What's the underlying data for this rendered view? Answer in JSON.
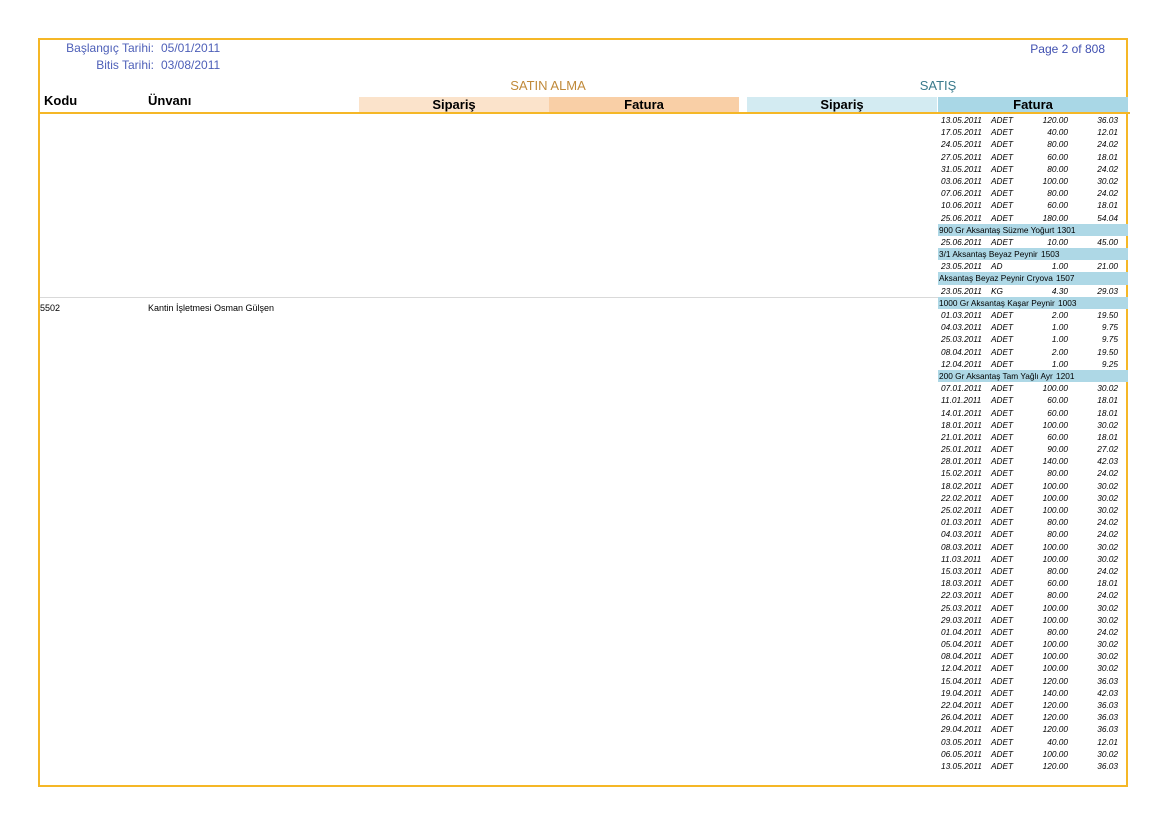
{
  "header": {
    "start_label": "Başlangıç Tarihi:",
    "start_value": "05/01/2011",
    "end_label": "Bitis Tarihi:",
    "end_value": "03/08/2011",
    "page": "Page 2 of 808"
  },
  "groups": {
    "buy": "SATIN ALMA",
    "sell": "SATIŞ"
  },
  "columns": {
    "kodu": "Kodu",
    "unvani": "Ünvanı",
    "buy_order": "Sipariş",
    "buy_invoice": "Fatura",
    "sell_order": "Sipariş",
    "sell_invoice": "Fatura"
  },
  "colors": {
    "border": "#f5b726",
    "buy_order_bg": "#fbe3cb",
    "buy_invoice_bg": "#f9cfa6",
    "sell_order_bg": "#d3ebf2",
    "sell_invoice_bg": "#a9d7e6",
    "product_bg": "#aed8e6"
  },
  "firm": {
    "code": "5502",
    "name": "Kantin İşletmesi Osman Gülşen"
  },
  "lines": [
    {
      "t": "l",
      "d": "13.05.2011",
      "u": "ADET",
      "q": "120.00",
      "a": "36.03"
    },
    {
      "t": "l",
      "d": "17.05.2011",
      "u": "ADET",
      "q": "40.00",
      "a": "12.01"
    },
    {
      "t": "l",
      "d": "24.05.2011",
      "u": "ADET",
      "q": "80.00",
      "a": "24.02"
    },
    {
      "t": "l",
      "d": "27.05.2011",
      "u": "ADET",
      "q": "60.00",
      "a": "18.01"
    },
    {
      "t": "l",
      "d": "31.05.2011",
      "u": "ADET",
      "q": "80.00",
      "a": "24.02"
    },
    {
      "t": "l",
      "d": "03.06.2011",
      "u": "ADET",
      "q": "100.00",
      "a": "30.02"
    },
    {
      "t": "l",
      "d": "07.06.2011",
      "u": "ADET",
      "q": "80.00",
      "a": "24.02"
    },
    {
      "t": "l",
      "d": "10.06.2011",
      "u": "ADET",
      "q": "60.00",
      "a": "18.01"
    },
    {
      "t": "l",
      "d": "25.06.2011",
      "u": "ADET",
      "q": "180.00",
      "a": "54.04"
    },
    {
      "t": "p",
      "n": "900 Gr Aksantaş Süzme Yoğurt",
      "c": "1301"
    },
    {
      "t": "l",
      "d": "25.06.2011",
      "u": "ADET",
      "q": "10.00",
      "a": "45.00"
    },
    {
      "t": "p",
      "n": "3/1 Aksantaş Beyaz Peynir",
      "c": "1503"
    },
    {
      "t": "l",
      "d": "23.05.2011",
      "u": "AD",
      "q": "1.00",
      "a": "21.00"
    },
    {
      "t": "p",
      "n": "Aksantaş Beyaz Peynir Cryova",
      "c": "1507"
    },
    {
      "t": "l",
      "d": "23.05.2011",
      "u": "KG",
      "q": "4.30",
      "a": "29.03"
    },
    {
      "t": "p",
      "n": "1000 Gr Aksantaş Kaşar Peynir",
      "c": "1003"
    },
    {
      "t": "l",
      "d": "01.03.2011",
      "u": "ADET",
      "q": "2.00",
      "a": "19.50"
    },
    {
      "t": "l",
      "d": "04.03.2011",
      "u": "ADET",
      "q": "1.00",
      "a": "9.75"
    },
    {
      "t": "l",
      "d": "25.03.2011",
      "u": "ADET",
      "q": "1.00",
      "a": "9.75"
    },
    {
      "t": "l",
      "d": "08.04.2011",
      "u": "ADET",
      "q": "2.00",
      "a": "19.50"
    },
    {
      "t": "l",
      "d": "12.04.2011",
      "u": "ADET",
      "q": "1.00",
      "a": "9.25"
    },
    {
      "t": "p",
      "n": "200 Gr Aksantaş Tam Yağlı Ayr",
      "c": "1201"
    },
    {
      "t": "l",
      "d": "07.01.2011",
      "u": "ADET",
      "q": "100.00",
      "a": "30.02"
    },
    {
      "t": "l",
      "d": "11.01.2011",
      "u": "ADET",
      "q": "60.00",
      "a": "18.01"
    },
    {
      "t": "l",
      "d": "14.01.2011",
      "u": "ADET",
      "q": "60.00",
      "a": "18.01"
    },
    {
      "t": "l",
      "d": "18.01.2011",
      "u": "ADET",
      "q": "100.00",
      "a": "30.02"
    },
    {
      "t": "l",
      "d": "21.01.2011",
      "u": "ADET",
      "q": "60.00",
      "a": "18.01"
    },
    {
      "t": "l",
      "d": "25.01.2011",
      "u": "ADET",
      "q": "90.00",
      "a": "27.02"
    },
    {
      "t": "l",
      "d": "28.01.2011",
      "u": "ADET",
      "q": "140.00",
      "a": "42.03"
    },
    {
      "t": "l",
      "d": "15.02.2011",
      "u": "ADET",
      "q": "80.00",
      "a": "24.02"
    },
    {
      "t": "l",
      "d": "18.02.2011",
      "u": "ADET",
      "q": "100.00",
      "a": "30.02"
    },
    {
      "t": "l",
      "d": "22.02.2011",
      "u": "ADET",
      "q": "100.00",
      "a": "30.02"
    },
    {
      "t": "l",
      "d": "25.02.2011",
      "u": "ADET",
      "q": "100.00",
      "a": "30.02"
    },
    {
      "t": "l",
      "d": "01.03.2011",
      "u": "ADET",
      "q": "80.00",
      "a": "24.02"
    },
    {
      "t": "l",
      "d": "04.03.2011",
      "u": "ADET",
      "q": "80.00",
      "a": "24.02"
    },
    {
      "t": "l",
      "d": "08.03.2011",
      "u": "ADET",
      "q": "100.00",
      "a": "30.02"
    },
    {
      "t": "l",
      "d": "11.03.2011",
      "u": "ADET",
      "q": "100.00",
      "a": "30.02"
    },
    {
      "t": "l",
      "d": "15.03.2011",
      "u": "ADET",
      "q": "80.00",
      "a": "24.02"
    },
    {
      "t": "l",
      "d": "18.03.2011",
      "u": "ADET",
      "q": "60.00",
      "a": "18.01"
    },
    {
      "t": "l",
      "d": "22.03.2011",
      "u": "ADET",
      "q": "80.00",
      "a": "24.02"
    },
    {
      "t": "l",
      "d": "25.03.2011",
      "u": "ADET",
      "q": "100.00",
      "a": "30.02"
    },
    {
      "t": "l",
      "d": "29.03.2011",
      "u": "ADET",
      "q": "100.00",
      "a": "30.02"
    },
    {
      "t": "l",
      "d": "01.04.2011",
      "u": "ADET",
      "q": "80.00",
      "a": "24.02"
    },
    {
      "t": "l",
      "d": "05.04.2011",
      "u": "ADET",
      "q": "100.00",
      "a": "30.02"
    },
    {
      "t": "l",
      "d": "08.04.2011",
      "u": "ADET",
      "q": "100.00",
      "a": "30.02"
    },
    {
      "t": "l",
      "d": "12.04.2011",
      "u": "ADET",
      "q": "100.00",
      "a": "30.02"
    },
    {
      "t": "l",
      "d": "15.04.2011",
      "u": "ADET",
      "q": "120.00",
      "a": "36.03"
    },
    {
      "t": "l",
      "d": "19.04.2011",
      "u": "ADET",
      "q": "140.00",
      "a": "42.03"
    },
    {
      "t": "l",
      "d": "22.04.2011",
      "u": "ADET",
      "q": "120.00",
      "a": "36.03"
    },
    {
      "t": "l",
      "d": "26.04.2011",
      "u": "ADET",
      "q": "120.00",
      "a": "36.03"
    },
    {
      "t": "l",
      "d": "29.04.2011",
      "u": "ADET",
      "q": "120.00",
      "a": "36.03"
    },
    {
      "t": "l",
      "d": "03.05.2011",
      "u": "ADET",
      "q": "40.00",
      "a": "12.01"
    },
    {
      "t": "l",
      "d": "06.05.2011",
      "u": "ADET",
      "q": "100.00",
      "a": "30.02"
    },
    {
      "t": "l",
      "d": "13.05.2011",
      "u": "ADET",
      "q": "120.00",
      "a": "36.03"
    }
  ]
}
